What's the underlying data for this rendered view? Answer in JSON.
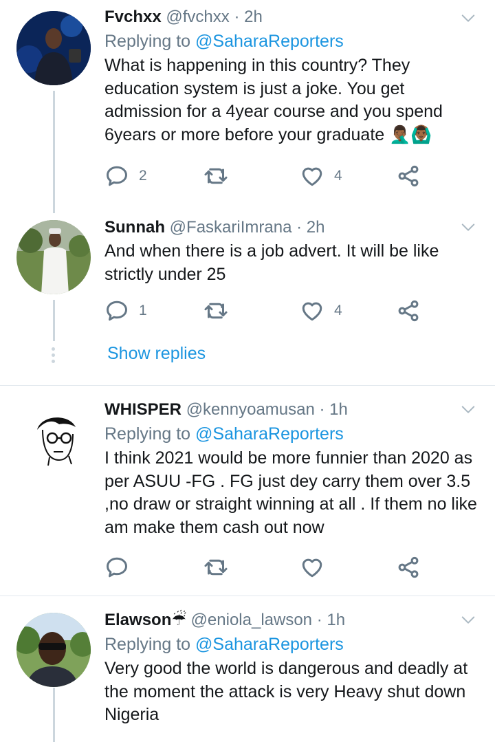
{
  "tweets": [
    {
      "name": "Fvchxx",
      "handle": "@fvchxx",
      "time": "2h",
      "replying_prefix": "Replying to",
      "replying_to": "@SaharaReporters",
      "text": "What is happening in this country? They education system is just a joke. You get admission for a 4year course and you spend 6years or more before your graduate 🤦🏾‍♂️🙆🏾‍♂️",
      "replies": "2",
      "retweets": "",
      "likes": "4"
    },
    {
      "name": "Sunnah",
      "handle": "@FaskariImrana",
      "time": "2h",
      "text": "And when there is a job advert. It will be like strictly under 25",
      "replies": "1",
      "retweets": "",
      "likes": "4"
    },
    {
      "name": "WHISPER",
      "handle": "@kennyoamusan",
      "time": "1h",
      "replying_prefix": "Replying to",
      "replying_to": "@SaharaReporters",
      "text": "I think 2021 would be more funnier than 2020 as per ASUU -FG . FG just dey carry them over 3.5 ,no draw or straight winning at all . If them no like am make them cash out now",
      "replies": "",
      "retweets": "",
      "likes": ""
    },
    {
      "name": "Elawson☔",
      "handle": "@eniola_lawson",
      "time": "1h",
      "replying_prefix": "Replying to",
      "replying_to": "@SaharaReporters",
      "text": "Very good the world is dangerous and  deadly at the moment the attack is very Heavy shut down Nigeria"
    }
  ],
  "show_replies": "Show replies",
  "separator_dot": "·",
  "icons": [
    "reply-icon",
    "retweet-icon",
    "like-icon",
    "share-icon",
    "chevron-down-icon"
  ],
  "colors": {
    "link": "#1b95e0",
    "secondary": "#657786",
    "text": "#14171a",
    "divider": "#e1e8ed"
  }
}
